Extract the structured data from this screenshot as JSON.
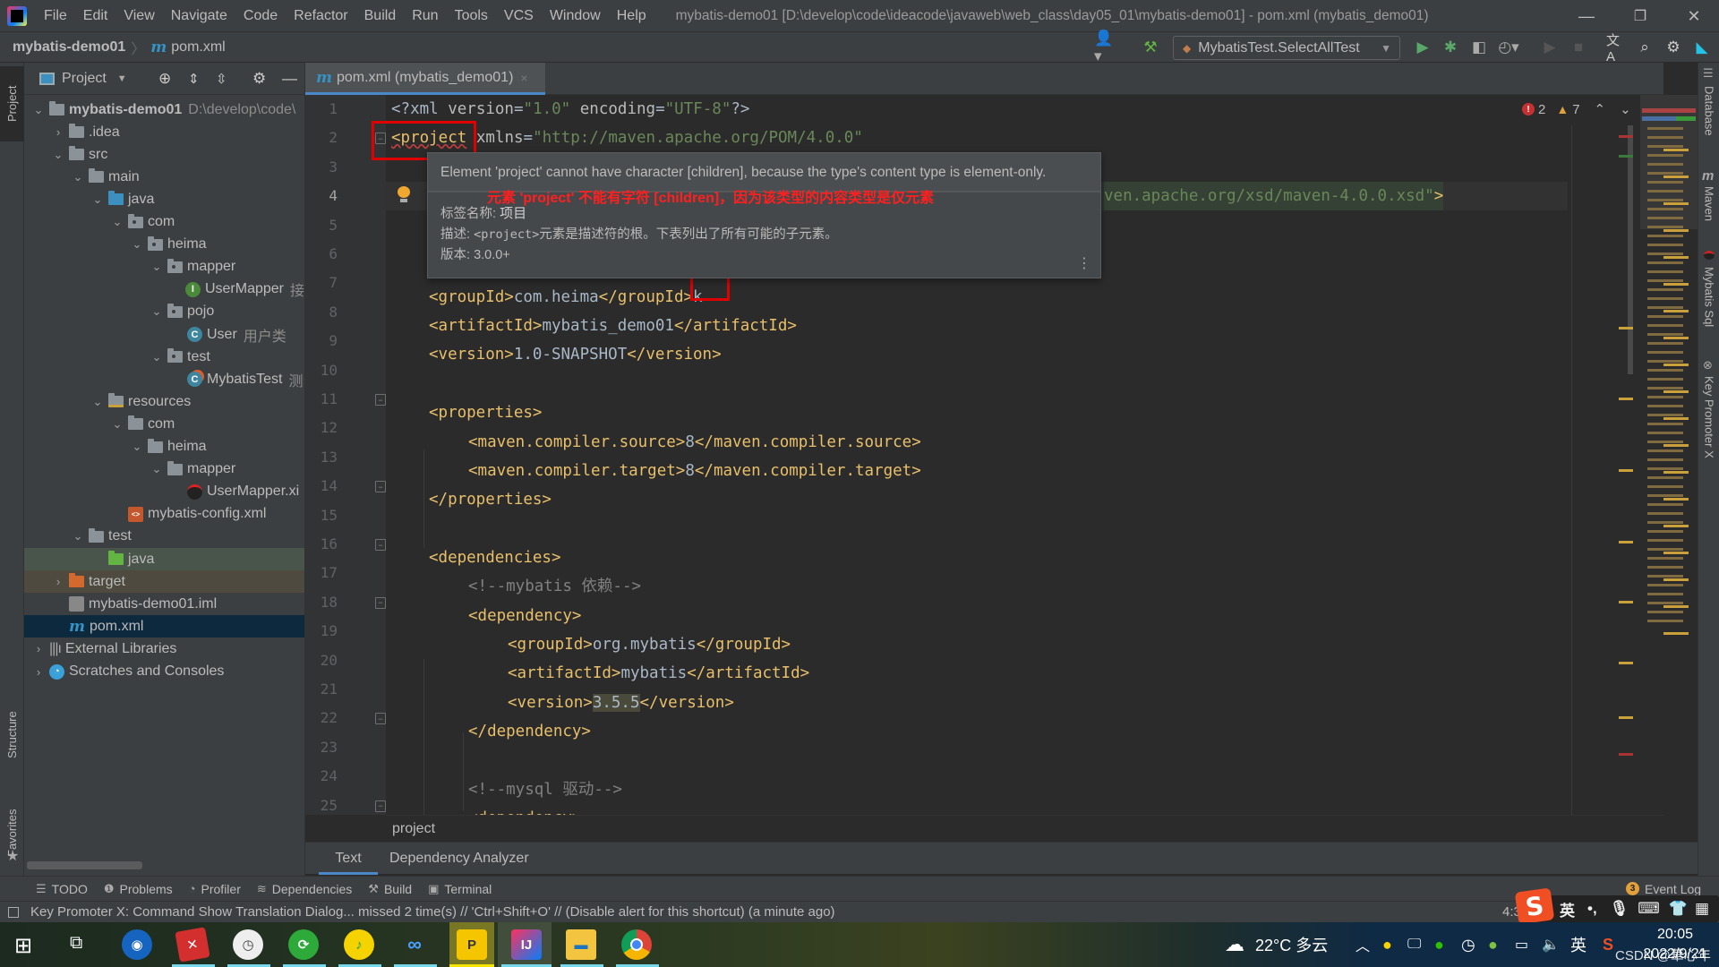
{
  "window": {
    "title": "mybatis-demo01 [D:\\develop\\code\\ideacode\\javaweb\\web_class\\day05_01\\mybatis-demo01] - pom.xml (mybatis_demo01)",
    "controls": {
      "minimize": "—",
      "maximize": "❐",
      "close": "✕"
    }
  },
  "menu": [
    "File",
    "Edit",
    "View",
    "Navigate",
    "Code",
    "Refactor",
    "Build",
    "Run",
    "Tools",
    "VCS",
    "Window",
    "Help"
  ],
  "breadcrumb": {
    "project": "mybatis-demo01",
    "separator": "〉",
    "file_icon": "m",
    "file": "pom.xml"
  },
  "toolbar": {
    "run_config": "MybatisTest.SelectAllTest",
    "icons": [
      "user-icon",
      "build-hammer-icon",
      "run-icon",
      "debug-icon",
      "coverage-icon",
      "profile-icon",
      "resume-icon",
      "stop-icon",
      "translate-icon",
      "search-icon",
      "settings-icon",
      "toolbox-icon"
    ]
  },
  "left_stripe": {
    "project": "Project",
    "structure": "Structure",
    "favorites": "Favorites"
  },
  "project_panel": {
    "title": "Project",
    "tree": [
      {
        "label": "mybatis-demo01",
        "hint": "D:\\develop\\code\\",
        "indent": 0,
        "arrow": "v",
        "icon": "module",
        "bold": true
      },
      {
        "label": ".idea",
        "indent": 1,
        "arrow": ">",
        "icon": "folder"
      },
      {
        "label": "src",
        "indent": 1,
        "arrow": "v",
        "icon": "folder"
      },
      {
        "label": "main",
        "indent": 2,
        "arrow": "v",
        "icon": "folder"
      },
      {
        "label": "java",
        "indent": 3,
        "arrow": "v",
        "icon": "folder-blue"
      },
      {
        "label": "com",
        "indent": 4,
        "arrow": "v",
        "icon": "package"
      },
      {
        "label": "heima",
        "indent": 5,
        "arrow": "v",
        "icon": "package"
      },
      {
        "label": "mapper",
        "indent": 6,
        "arrow": "v",
        "icon": "package"
      },
      {
        "label": "UserMapper",
        "hint": "接",
        "indent": 7,
        "arrow": "",
        "icon": "interface"
      },
      {
        "label": "pojo",
        "indent": 6,
        "arrow": "v",
        "icon": "package"
      },
      {
        "label": "User",
        "hint": "用户类",
        "indent": 7,
        "arrow": "",
        "icon": "class"
      },
      {
        "label": "test",
        "indent": 6,
        "arrow": "v",
        "icon": "package"
      },
      {
        "label": "MybatisTest",
        "hint": "测",
        "indent": 7,
        "arrow": "",
        "icon": "class-test"
      },
      {
        "label": "resources",
        "indent": 3,
        "arrow": "v",
        "icon": "folder-res"
      },
      {
        "label": "com",
        "indent": 4,
        "arrow": "v",
        "icon": "folder"
      },
      {
        "label": "heima",
        "indent": 5,
        "arrow": "v",
        "icon": "folder"
      },
      {
        "label": "mapper",
        "indent": 6,
        "arrow": "v",
        "icon": "folder"
      },
      {
        "label": "UserMapper.xi",
        "indent": 7,
        "arrow": "",
        "icon": "mybatis"
      },
      {
        "label": "mybatis-config.xml",
        "indent": 4,
        "arrow": "",
        "icon": "xml"
      },
      {
        "label": "test",
        "indent": 2,
        "arrow": "v",
        "icon": "folder"
      },
      {
        "label": "java",
        "indent": 3,
        "arrow": "",
        "icon": "folder-green",
        "bg": "#49544a"
      },
      {
        "label": "target",
        "indent": 1,
        "arrow": ">",
        "icon": "folder-orange",
        "bg": "#4e4a3f"
      },
      {
        "label": "mybatis-demo01.iml",
        "indent": 1,
        "arrow": "",
        "icon": "iml"
      },
      {
        "label": "pom.xml",
        "indent": 1,
        "arrow": "",
        "icon": "maven",
        "bg": "#0d293e"
      },
      {
        "label": "External Libraries",
        "indent": 0,
        "arrow": ">",
        "icon": "libraries"
      },
      {
        "label": "Scratches and Consoles",
        "indent": 0,
        "arrow": ">",
        "icon": "scratches"
      }
    ]
  },
  "editor": {
    "tab": {
      "icon": "m",
      "label": "pom.xml (mybatis_demo01)",
      "close": "×"
    },
    "inspection": {
      "errors": "2",
      "warnings": "7"
    },
    "lines": [
      {
        "n": "1"
      },
      {
        "n": "2"
      },
      {
        "n": "3"
      },
      {
        "n": "4"
      },
      {
        "n": "5"
      },
      {
        "n": "6"
      },
      {
        "n": "7"
      },
      {
        "n": "8"
      },
      {
        "n": "9"
      },
      {
        "n": "10"
      },
      {
        "n": "11"
      },
      {
        "n": "12"
      },
      {
        "n": "13"
      },
      {
        "n": "14"
      },
      {
        "n": "15"
      },
      {
        "n": "16"
      },
      {
        "n": "17"
      },
      {
        "n": "18"
      },
      {
        "n": "19"
      },
      {
        "n": "20"
      },
      {
        "n": "21"
      },
      {
        "n": "22"
      },
      {
        "n": "23"
      },
      {
        "n": "24"
      },
      {
        "n": "25"
      }
    ],
    "code": {
      "l1": {
        "p1": "<?xml ",
        "a1": "version",
        "e1": "=",
        "s1": "\"1.0\"",
        "sp": " ",
        "a2": "encoding",
        "e2": "=",
        "s2": "\"UTF-8\"",
        "end": "?>"
      },
      "l2": {
        "tag": "<project",
        "sp": " ",
        "attr": "xmlns",
        "eq": "=",
        "val": "\"http://maven.apache.org/POM/4.0.0\""
      },
      "l4": {
        "val": "ven.apache.org/xsd/maven-4.0.0.xsd\"",
        "end": ">"
      },
      "l7": {
        "open": "<groupId>",
        "text": "com.heima",
        "close": "</groupId>",
        "extra": "k"
      },
      "l8": {
        "open": "<artifactId>",
        "text": "mybatis_demo01",
        "close": "</artifactId>"
      },
      "l9": {
        "open": "<version>",
        "text": "1.0-SNAPSHOT",
        "close": "</version>"
      },
      "l11": {
        "tag": "<properties>"
      },
      "l12": {
        "open": "<maven.compiler.source>",
        "text": "8",
        "close": "</maven.compiler.source>"
      },
      "l13": {
        "open": "<maven.compiler.target>",
        "text": "8",
        "close": "</maven.compiler.target>"
      },
      "l14": {
        "tag": "</properties>"
      },
      "l16": {
        "tag": "<dependencies>"
      },
      "l17": {
        "comment": "<!--mybatis 依赖-->"
      },
      "l18": {
        "tag": "<dependency>"
      },
      "l19": {
        "open": "<groupId>",
        "text": "org.mybatis",
        "close": "</groupId>"
      },
      "l20": {
        "open": "<artifactId>",
        "text": "mybatis",
        "close": "</artifactId>"
      },
      "l21": {
        "open": "<version>",
        "text": "3.5.5",
        "close": "</version>"
      },
      "l22": {
        "tag": "</dependency>"
      },
      "l24": {
        "comment": "<!--mysql 驱动-->"
      },
      "l25": {
        "tag": "<dependency>"
      }
    },
    "tooltip": {
      "message": "Element 'project' cannot have character [children], because the type's content type is element-only.",
      "translation": "元素 'project' 不能有字符 [children]，因为该类型的内容类型是仅元素",
      "tag_name_label": "标签名称:",
      "tag_name": "项目",
      "desc_label": "描述:",
      "desc_code": "<project>",
      "desc_text": "元素是描述符的根。下表列出了所有可能的子元素。",
      "version_label": "版本:",
      "version": "3.0.0+",
      "more": "⋮"
    },
    "structure_crumb": "project",
    "bottom_tabs": [
      "Text",
      "Dependency Analyzer"
    ]
  },
  "right_stripe": [
    "Database",
    "Maven",
    "Mybatis Sql",
    "Key Promoter X"
  ],
  "tool_windows": [
    {
      "icon": "☰",
      "label": "TODO"
    },
    {
      "icon": "❶",
      "label": "Problems"
    },
    {
      "icon": "◔",
      "label": "Profiler"
    },
    {
      "icon": "≋",
      "label": "Dependencies"
    },
    {
      "icon": "⚒",
      "label": "Build"
    },
    {
      "icon": "▣",
      "label": "Terminal"
    }
  ],
  "event_log": {
    "count": "3",
    "label": "Event Log"
  },
  "status": {
    "message": "Key Promoter X: Command Show Translation Dialog... missed 2 time(s) // 'Ctrl+Shift+O' // (Disable alert for this shortcut) (a minute ago)",
    "position": "4:3"
  },
  "ime": {
    "mode": "英",
    "punct": "•,"
  },
  "taskbar": {
    "weather": "22°C 多云",
    "lang": "英",
    "time": "20:05",
    "date": "2022/9/21",
    "watermark": "CSDN @華心年"
  }
}
